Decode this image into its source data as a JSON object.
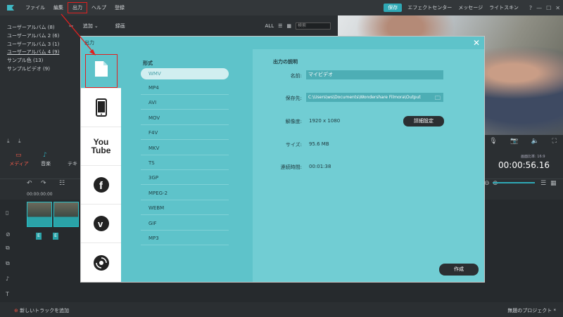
{
  "menubar": {
    "items": [
      "ファイル",
      "編集",
      "出力",
      "ヘルプ",
      "登録"
    ],
    "highlighted_index": 2,
    "save_label": "保存",
    "effect_center": "エフェクトセンター",
    "messages": "メッセージ",
    "light_skin": "ライトスキン",
    "window_buttons": [
      "?",
      "—",
      "☐",
      "✕"
    ]
  },
  "library": {
    "albums": [
      "ユーザーアルバム (8)",
      "ユーザーアルバム 2 (6)",
      "ユーザーアルバム 3 (1)",
      "ユーザーアルバム 4 (9)",
      "サンプル色 (13)",
      "サンプルビデオ (9)"
    ],
    "selected_album_index": 3,
    "add_label": "追加",
    "record_label": "録画",
    "all_label": "ALL",
    "search_placeholder": "検索"
  },
  "tabs": {
    "media": "メディア",
    "music": "音楽",
    "text": "テキ"
  },
  "player": {
    "timecode": "00:00:56.16",
    "ratio_label": "画面比率: 16:9"
  },
  "timeline": {
    "start_time": "00:00:00:00",
    "add_track": "新しいトラックを追加",
    "project_name": "無題のプロジェクト *"
  },
  "dialog": {
    "title": "出力",
    "close": "✕",
    "format_heading": "形式",
    "formats": [
      "WMV",
      "MP4",
      "AVI",
      "MOV",
      "F4V",
      "MKV",
      "TS",
      "3GP",
      "MPEG-2",
      "WEBM",
      "GIF",
      "MP3"
    ],
    "selected_format_index": 0,
    "devices": [
      "file-icon",
      "phone-icon",
      "youtube-icon",
      "facebook-icon",
      "vimeo-icon",
      "dvd-icon"
    ],
    "youtube_text": [
      "You",
      "Tube"
    ],
    "desc_heading": "出力の説明",
    "name_label": "名前:",
    "name_value": "マイビデオ",
    "save_to_label": "保存先:",
    "save_to_value": "C:\\Users\\ws\\Documents\\Wondershare Filmora\\Output",
    "resolution_label": "解像度:",
    "resolution_value": "1920 x 1080",
    "advanced_label": "詳細設定",
    "size_label": "サイズ:",
    "size_value": "95.6 MB",
    "duration_label": "連続時間:",
    "duration_value": "00:01:38",
    "create_label": "作成"
  },
  "colors": {
    "accent": "#2fa8b5",
    "dialog_bg": "#5ec3ca",
    "highlight_red": "#e02020"
  }
}
